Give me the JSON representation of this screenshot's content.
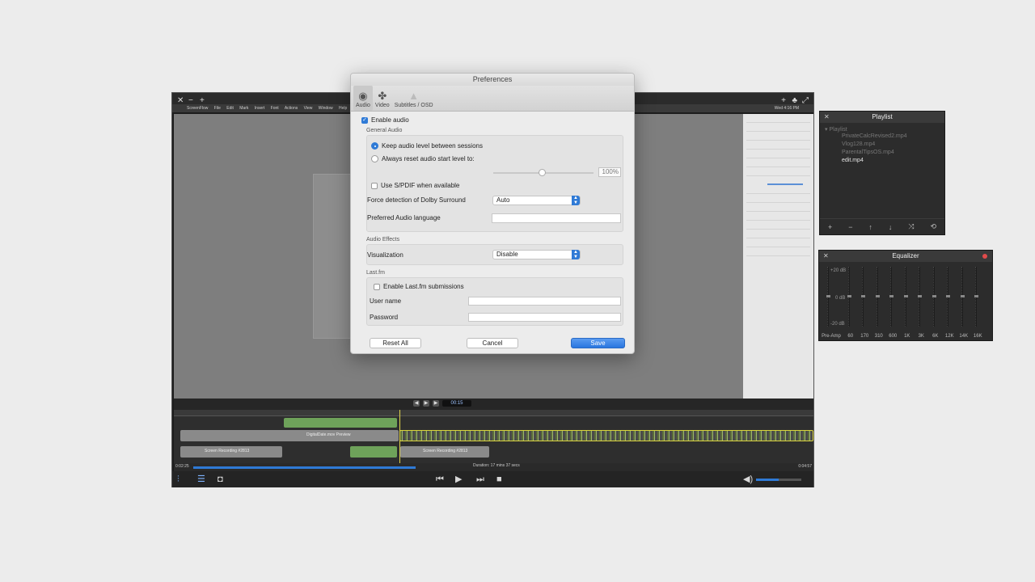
{
  "player": {
    "menu": [
      "ScreenFlow",
      "File",
      "Edit",
      "Mark",
      "Insert",
      "Font",
      "Actions",
      "View",
      "Window",
      "Help"
    ],
    "status": "Wed 4:16 PM",
    "timecode": "00:15",
    "time_elapsed": "0:02:25",
    "time_total": "0:04:57",
    "duration_text": "Duration: 17 mins 37 secs",
    "progress": 0.37,
    "volume": 0.5,
    "track_labels": [
      "DigitalDate.mov  Preview",
      "Screen Recording #2813",
      "Screen Recording #2813"
    ],
    "icons": {
      "equalizer": "equalizer-icon",
      "playlist": "playlist-icon",
      "snapshot": "camera-icon",
      "previous": "previous-icon",
      "play": "play-icon",
      "next": "next-icon",
      "stop": "stop-icon",
      "volume": "volume-icon"
    }
  },
  "preferences": {
    "title": "Preferences",
    "tabs": [
      {
        "label": "Audio",
        "icon": "speaker-icon",
        "selected": true
      },
      {
        "label": "Video",
        "icon": "film-reel-icon",
        "selected": false
      },
      {
        "label": "Subtitles / OSD",
        "icon": "subtitles-icon",
        "selected": false
      }
    ],
    "enable_audio": {
      "label": "Enable audio",
      "checked": true
    },
    "general_audio": {
      "title": "General Audio",
      "keep_level": {
        "label": "Keep audio level between sessions",
        "selected": true
      },
      "reset_level": {
        "label": "Always reset audio start level to:",
        "selected": false
      },
      "level_value": "100%",
      "spdif": {
        "label": "Use S/PDIF when available",
        "checked": false
      },
      "dolby": {
        "label": "Force detection of Dolby Surround",
        "value": "Auto"
      },
      "preferred_language": {
        "label": "Preferred Audio language",
        "value": ""
      }
    },
    "audio_effects": {
      "title": "Audio Effects",
      "visualization": {
        "label": "Visualization",
        "value": "Disable"
      }
    },
    "lastfm": {
      "title": "Last.fm",
      "enable": {
        "label": "Enable Last.fm submissions",
        "checked": false
      },
      "username": {
        "label": "User name",
        "value": ""
      },
      "password": {
        "label": "Password",
        "value": ""
      }
    },
    "buttons": {
      "reset": "Reset All",
      "cancel": "Cancel",
      "save": "Save"
    }
  },
  "playlist": {
    "title": "Playlist",
    "root": "Playlist",
    "items": [
      {
        "name": "PrivateCalcRevised2.mp4",
        "active": false
      },
      {
        "name": "Vlog128.mp4",
        "active": false
      },
      {
        "name": "ParentalTipsOS.mp4",
        "active": false
      },
      {
        "name": "edit.mp4",
        "active": true
      }
    ],
    "tools": [
      "add-icon",
      "remove-icon",
      "move-up-icon",
      "move-down-icon",
      "shuffle-icon",
      "repeat-icon"
    ]
  },
  "equalizer": {
    "title": "Equalizer",
    "db_top": "+20 dB",
    "db_mid": "0 dB",
    "db_bottom": "-20 dB",
    "bands": [
      "Pre-Amp",
      "60",
      "170",
      "310",
      "600",
      "1K",
      "3K",
      "6K",
      "12K",
      "14K",
      "16K"
    ]
  },
  "colors": {
    "accent": "#2f7ad6",
    "dialog_bg": "#ececec",
    "panel_bg": "#2c2c2c"
  }
}
